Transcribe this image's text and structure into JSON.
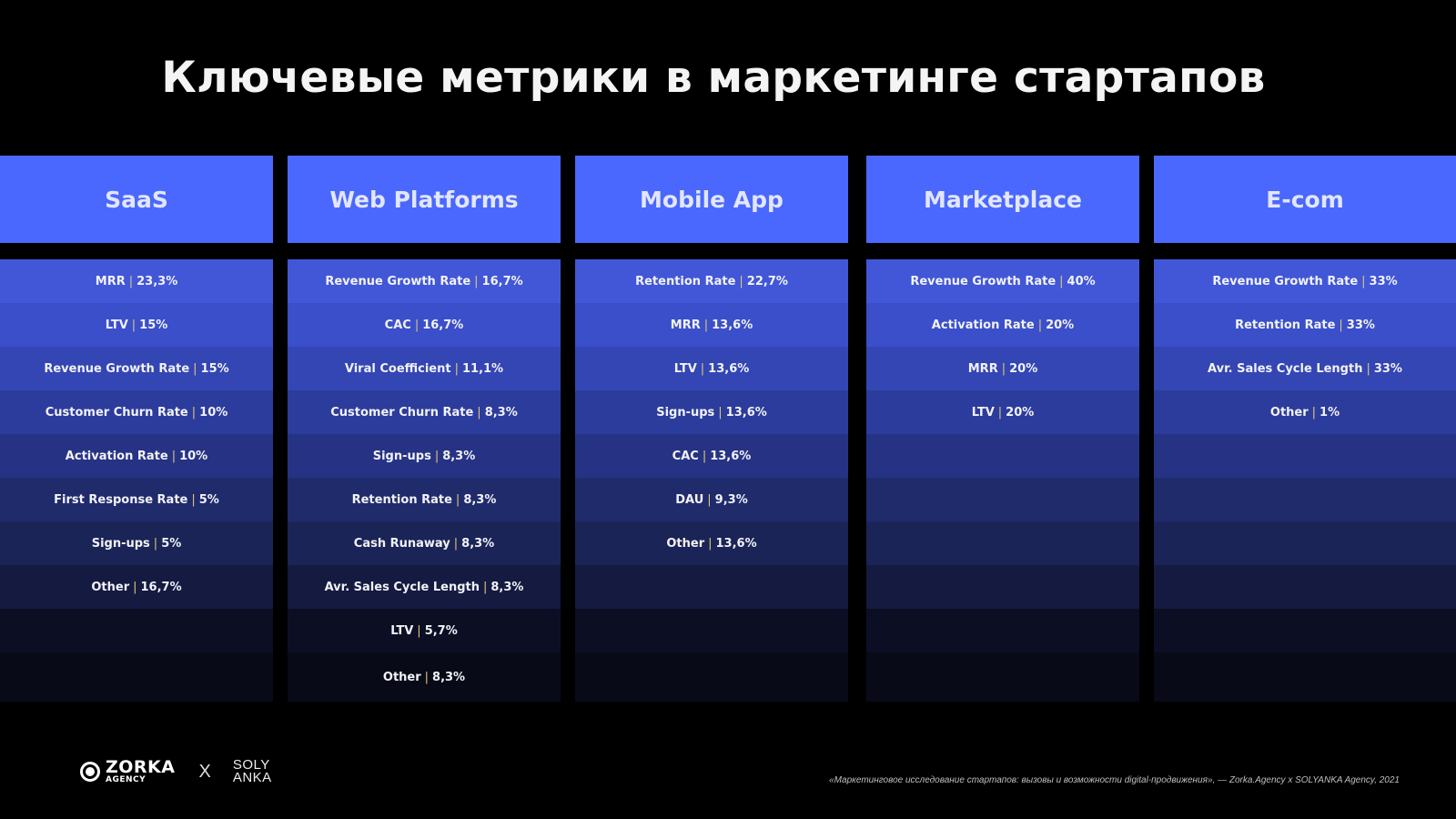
{
  "title": "Ключевые метрики в маркетинге стартапов",
  "separator": "|",
  "colors": {
    "background": "#000000",
    "header": "#4a68fd",
    "header_text": "#e2e6ff",
    "separator": "#e3c77a",
    "row_gradient": [
      "#4157d8",
      "#3a4fc9",
      "#3346b4",
      "#2c3c9c",
      "#263384",
      "#202b6c",
      "#1b2457",
      "#141a40",
      "#0c0f24",
      "#080a18"
    ]
  },
  "columns": [
    {
      "name": "SaaS",
      "metrics": [
        {
          "label": "MRR",
          "value": "23,3%"
        },
        {
          "label": "LTV",
          "value": "15%"
        },
        {
          "label": "Revenue Growth Rate",
          "value": "15%"
        },
        {
          "label": "Customer Churn Rate",
          "value": "10%"
        },
        {
          "label": "Activation Rate",
          "value": "10%"
        },
        {
          "label": "First Response Rate",
          "value": "5%"
        },
        {
          "label": "Sign-ups",
          "value": "5%"
        },
        {
          "label": "Other",
          "value": "16,7%"
        }
      ]
    },
    {
      "name": "Web Platforms",
      "metrics": [
        {
          "label": "Revenue Growth Rate",
          "value": "16,7%"
        },
        {
          "label": "CAC",
          "value": "16,7%"
        },
        {
          "label": "Viral Coefficient",
          "value": "11,1%"
        },
        {
          "label": "Customer Churn Rate",
          "value": "8,3%"
        },
        {
          "label": "Sign-ups",
          "value": "8,3%"
        },
        {
          "label": "Retention Rate",
          "value": "8,3%"
        },
        {
          "label": "Cash Runaway",
          "value": "8,3%"
        },
        {
          "label": "Avr. Sales Cycle Length",
          "value": "8,3%"
        },
        {
          "label": "LTV",
          "value": "5,7%"
        },
        {
          "label": "Other",
          "value": "8,3%"
        }
      ]
    },
    {
      "name": "Mobile App",
      "metrics": [
        {
          "label": "Retention Rate",
          "value": "22,7%"
        },
        {
          "label": "MRR",
          "value": "13,6%"
        },
        {
          "label": "LTV",
          "value": "13,6%"
        },
        {
          "label": "Sign-ups",
          "value": "13,6%"
        },
        {
          "label": "CAC",
          "value": "13,6%"
        },
        {
          "label": "DAU",
          "value": "9,3%"
        },
        {
          "label": "Other",
          "value": "13,6%"
        }
      ]
    },
    {
      "name": "Marketplace",
      "metrics": [
        {
          "label": "Revenue Growth Rate",
          "value": "40%"
        },
        {
          "label": "Activation Rate",
          "value": "20%"
        },
        {
          "label": "MRR",
          "value": "20%"
        },
        {
          "label": "LTV",
          "value": "20%"
        }
      ]
    },
    {
      "name": "E-com",
      "metrics": [
        {
          "label": "Revenue Growth Rate",
          "value": "33%"
        },
        {
          "label": "Retention Rate",
          "value": "33%"
        },
        {
          "label": "Avr. Sales Cycle Length",
          "value": "33%"
        },
        {
          "label": "Other",
          "value": "1%"
        }
      ]
    }
  ],
  "footer": {
    "logo_primary": "ZORKA",
    "logo_primary_sub": "AGENCY",
    "times": "X",
    "logo_secondary_line1": "SOLY",
    "logo_secondary_line2": "ANKA",
    "source": "«Маркетинговое исследование стартапов: вызовы и возможности digital-продвижения», — Zorka.Agency x SOLYANKA Agency, 2021"
  }
}
